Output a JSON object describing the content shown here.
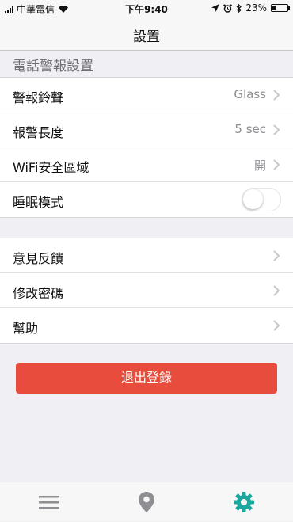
{
  "status_bar": {
    "carrier": "中華電信",
    "time": "下午9:40",
    "battery": "23%",
    "battery_level": 0.23,
    "icons": [
      "signal-icon",
      "wifi-icon",
      "location-arrow-icon",
      "alarm-icon",
      "bluetooth-icon",
      "battery-icon"
    ]
  },
  "nav": {
    "title": "設置"
  },
  "alarm_section": {
    "header": "電話警報設置",
    "rows": [
      {
        "label": "警報鈴聲",
        "value": "Glass"
      },
      {
        "label": "報警長度",
        "value": "5 sec"
      },
      {
        "label": "WiFi安全區域",
        "value": "開"
      },
      {
        "label": "睡眠模式",
        "toggle_on": false
      }
    ]
  },
  "other_section": {
    "rows": [
      {
        "label": "意見反饋"
      },
      {
        "label": "修改密碼"
      },
      {
        "label": "幫助"
      }
    ]
  },
  "logout": {
    "label": "退出登錄"
  },
  "tab_bar": {
    "items": [
      {
        "icon": "menu-icon",
        "active": false
      },
      {
        "icon": "map-pin-icon",
        "active": false
      },
      {
        "icon": "gear-icon",
        "active": true
      }
    ]
  },
  "colors": {
    "accent": "#1aa79d",
    "logout_button": "#e84c3d",
    "inactive_icon": "#8e8e93",
    "background": "#efeff4"
  }
}
